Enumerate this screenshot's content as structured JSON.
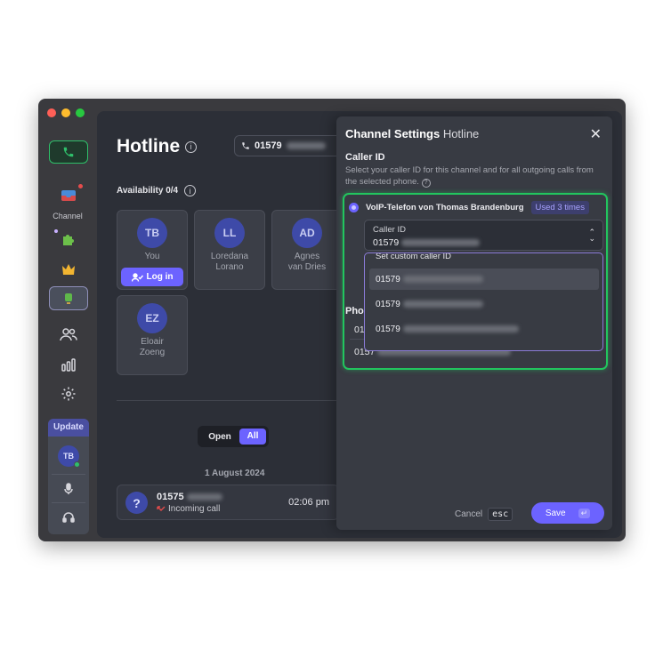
{
  "app": {
    "title": "Hotline",
    "phone_number": "01579",
    "availability": "Availability 0/4",
    "sidebar_channel_label": "Channel",
    "update_label": "Update",
    "user_initials": "TB"
  },
  "agents": [
    {
      "initials": "TB",
      "name": "You"
    },
    {
      "initials": "LL",
      "name": "Loredana\nLorano"
    },
    {
      "initials": "AD",
      "name": "Agnes\nvan Dries"
    },
    {
      "initials": "EZ",
      "name": "Eloair\nZoeng"
    }
  ],
  "login_label": "Log in",
  "filter": {
    "open_label": "Open",
    "all_label": "All"
  },
  "history": {
    "date": "1 August 2024",
    "call_number": "01575",
    "call_type": "Incoming call",
    "call_time": "02:06 pm"
  },
  "panel": {
    "title_bold": "Channel Settings",
    "title_rest": "Hotline",
    "caller_id_heading": "Caller ID",
    "caller_id_desc": "Select your caller ID for this channel and for all outgoing calls from the selected phone.",
    "phone_option": "VoIP-Telefon von Thomas Brandenburg",
    "used_badge": "Used 3 times",
    "select_label": "Caller ID",
    "select_value": "01579",
    "dropdown_header": "Set custom caller ID",
    "dropdown_options": [
      "01579",
      "01579",
      "01579"
    ],
    "phones_heading_partial": "Phon",
    "behind_row1": "01",
    "behind_row2": "0157",
    "cancel_label": "Cancel",
    "esc_label": "esc",
    "save_label": "Save",
    "enter_key": "↵"
  },
  "colors": {
    "accent": "#6c63ff",
    "green": "#22c55e",
    "dropdown_border": "#8b7bd8"
  }
}
